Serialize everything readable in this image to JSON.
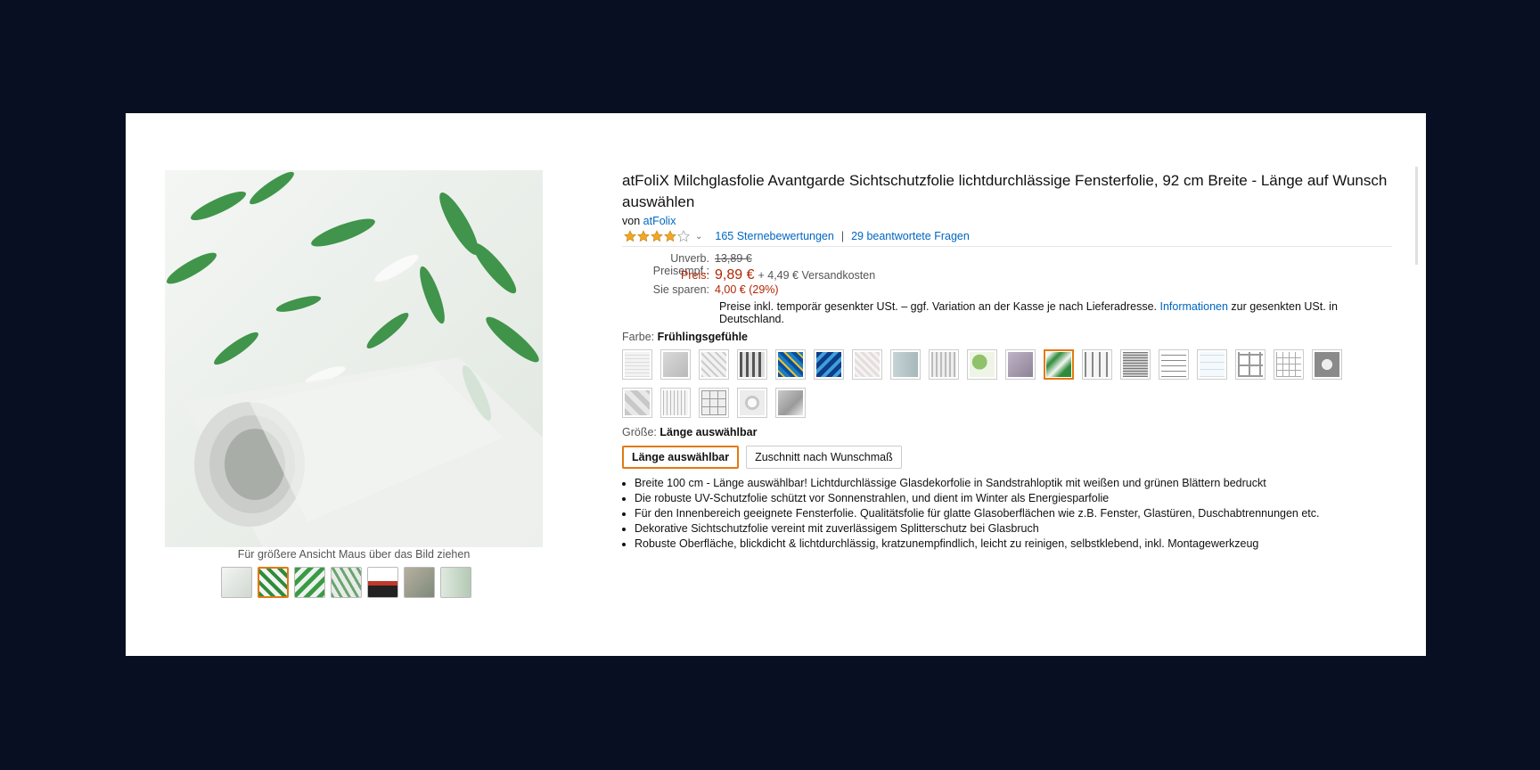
{
  "product": {
    "title": "atFoliX Milchglasfolie Avantgarde Sichtschutzfolie lichtdurchlässige Fensterfolie, 92 cm Breite - Länge auf Wunsch auswählen",
    "by_prefix": "von",
    "brand": "atFolix",
    "rating_stars": 4,
    "ratings_link": "165 Sternebewertungen",
    "rating_separator": "|",
    "questions_link": "29 beantwortete Fragen"
  },
  "gallery": {
    "zoom_hint": "Für größere Ansicht Maus über das Bild ziehen",
    "selected_thumb_index": 1,
    "thumb_count": 7
  },
  "pricing": {
    "list_label": "Unverb. Preisempf.:",
    "list_price": "13,89 €",
    "price_label": "Preis:",
    "price": "9,89 €",
    "shipping": "+ 4,49 € Versandkosten",
    "savings_label": "Sie sparen:",
    "savings": "4,00 € (29%)",
    "tax_note_before": "Preise inkl. temporär gesenkter USt. – ggf. Variation an der Kasse je nach Lieferadresse.",
    "tax_link": "Informationen",
    "tax_note_after": "zur gesenkten USt. in Deutschland."
  },
  "color": {
    "label": "Farbe:",
    "selected": "Frühlingsgefühle",
    "selected_swatch_index": 11,
    "swatch_count": 24
  },
  "size": {
    "label": "Größe:",
    "selected": "Länge auswählbar",
    "options": [
      "Länge auswählbar",
      "Zuschnitt nach Wunschmaß"
    ]
  },
  "bullets": [
    "Breite 100 cm - Länge auswählbar! Lichtdurchlässige Glasdekorfolie in Sandstrahloptik mit weißen und grünen Blättern bedruckt",
    "Die robuste UV-Schutzfolie schützt vor Sonnenstrahlen, und dient im Winter als Energiesparfolie",
    "Für den Innenbereich geeignete Fensterfolie. Qualitätsfolie für glatte Glasoberflächen wie z.B. Fenster, Glastüren, Duschabtrennungen etc.",
    "Dekorative Sichtschutzfolie vereint mit zuverlässigem Splitterschutz bei Glasbruch",
    "Robuste Oberfläche, blickdicht & lichtdurchlässig, kratzunempfindlich, leicht zu reinigen, selbstklebend, inkl. Montagewerkzeug"
  ],
  "colors": {
    "link": "#0066c0",
    "price": "#b12704",
    "selected_border": "#e47911",
    "star": "#f0a823",
    "leaf": "#2e8b3a"
  }
}
